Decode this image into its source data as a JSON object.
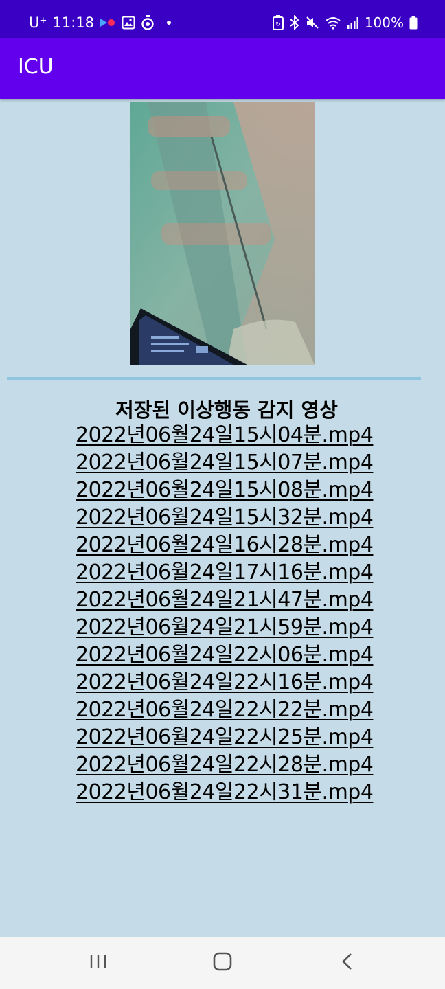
{
  "status_bar": {
    "carrier": "U⁺",
    "time": "11:18",
    "battery": "100%",
    "left_icons": [
      "media-icon",
      "image-icon",
      "timer-icon"
    ],
    "right_icons": [
      "battery-saver-icon",
      "bluetooth-icon",
      "mute-icon",
      "wifi-icon",
      "signal-icon",
      "battery-icon"
    ]
  },
  "app_bar": {
    "title": "ICU"
  },
  "camera": {
    "icon": "camera-preview"
  },
  "list": {
    "heading": "저장된 이상행동 감지 영상",
    "items": [
      "2022년06월24일15시04분.mp4",
      "2022년06월24일15시07분.mp4",
      "2022년06월24일15시08분.mp4",
      "2022년06월24일15시32분.mp4",
      "2022년06월24일16시28분.mp4",
      "2022년06월24일17시16분.mp4",
      "2022년06월24일21시47분.mp4",
      "2022년06월24일21시59분.mp4",
      "2022년06월24일22시06분.mp4",
      "2022년06월24일22시16분.mp4",
      "2022년06월24일22시22분.mp4",
      "2022년06월24일22시25분.mp4",
      "2022년06월24일22시28분.mp4",
      "2022년06월24일22시31분.mp4"
    ]
  },
  "nav_bar": {
    "icons": [
      "recents-icon",
      "home-icon",
      "back-icon"
    ]
  },
  "colors": {
    "status_bar": "#3a00c4",
    "app_bar": "#6200ee",
    "background": "#c5dce8",
    "divider": "#8fc6df"
  }
}
